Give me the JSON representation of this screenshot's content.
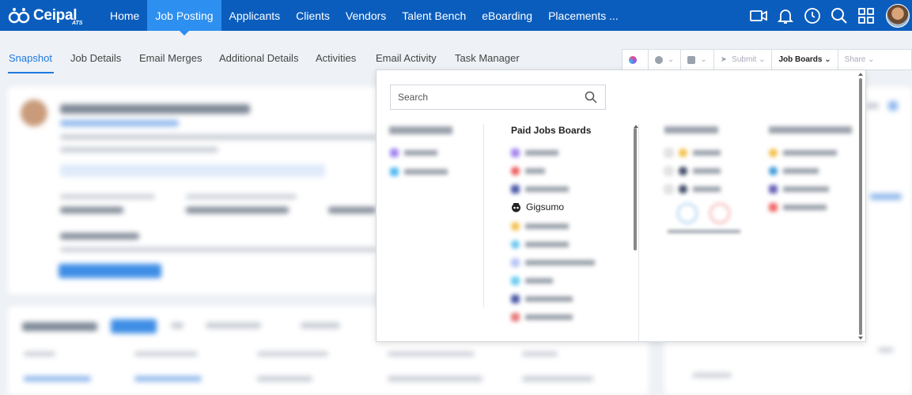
{
  "app": {
    "logo_text": "Ceipal",
    "logo_sub": "ATS"
  },
  "nav": {
    "items": [
      {
        "label": "Home"
      },
      {
        "label": "Job Posting",
        "active": true
      },
      {
        "label": "Applicants"
      },
      {
        "label": "Clients"
      },
      {
        "label": "Vendors"
      },
      {
        "label": "Talent Bench"
      },
      {
        "label": "eBoarding"
      },
      {
        "label": "Placements ..."
      }
    ],
    "icons": [
      "video-icon",
      "bell-icon",
      "history-icon",
      "search-icon",
      "apps-grid-icon"
    ],
    "accent": "#0a5dbd",
    "active_color": "#2d8ff0"
  },
  "subtabs": [
    {
      "label": "Snapshot",
      "active": true
    },
    {
      "label": "Job Details"
    },
    {
      "label": "Email Merges"
    },
    {
      "label": "Additional Details"
    },
    {
      "label": "Activities"
    },
    {
      "label": "Email Activity"
    },
    {
      "label": "Task Manager"
    }
  ],
  "toolbar": {
    "submit_label": "Submit",
    "job_boards_label": "Job Boards",
    "share_label": "Share"
  },
  "job_boards_panel": {
    "search_placeholder": "Search",
    "paid_heading": "Paid Jobs Boards",
    "visible_board": "Gigsumo"
  }
}
